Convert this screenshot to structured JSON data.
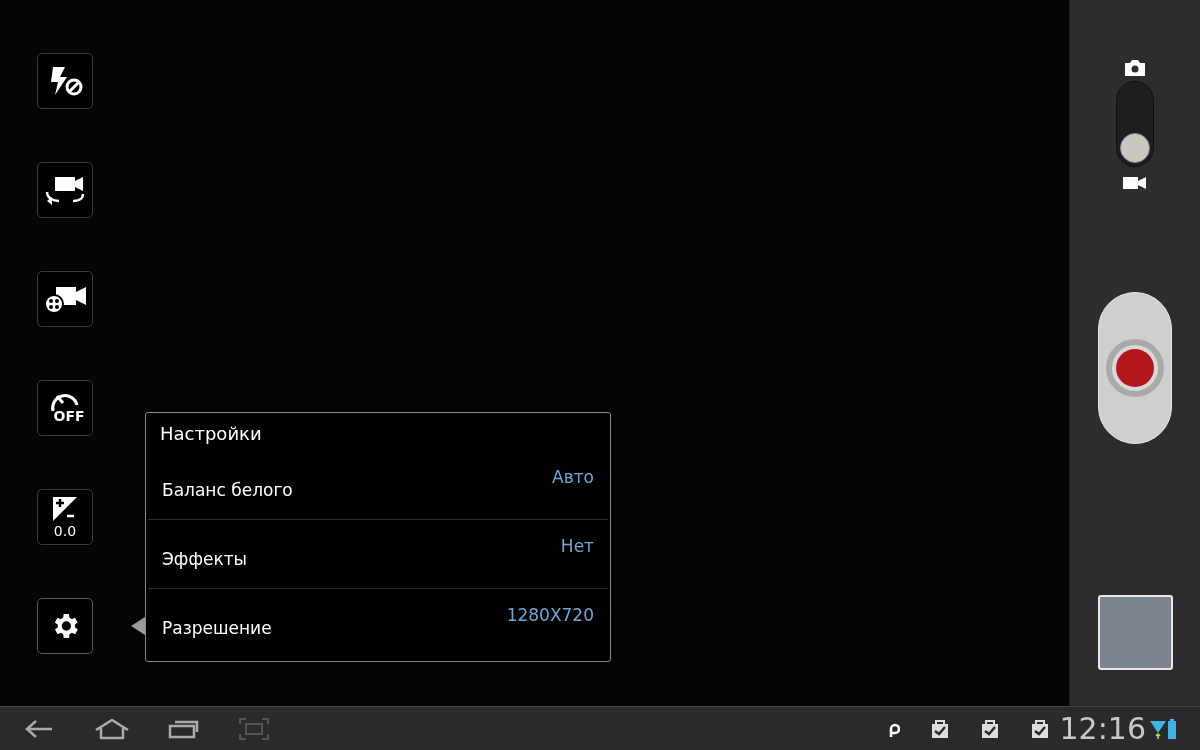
{
  "toolbar": [
    {
      "kind": "flash"
    },
    {
      "kind": "switch-camera"
    },
    {
      "kind": "recording-mode"
    },
    {
      "kind": "timer",
      "label": "OFF"
    },
    {
      "kind": "exposure",
      "label": "0.0"
    },
    {
      "kind": "settings",
      "selected": true
    }
  ],
  "settings_popup": {
    "title": "Настройки",
    "rows": [
      {
        "label": "Баланс белого",
        "value": "Авто"
      },
      {
        "label": "Эффекты",
        "value": "Нет"
      },
      {
        "label": "Разрешение",
        "value": "1280X720"
      }
    ]
  },
  "mode_switch": {
    "video_selected": true
  },
  "status_bar": {
    "time": "12:16"
  }
}
